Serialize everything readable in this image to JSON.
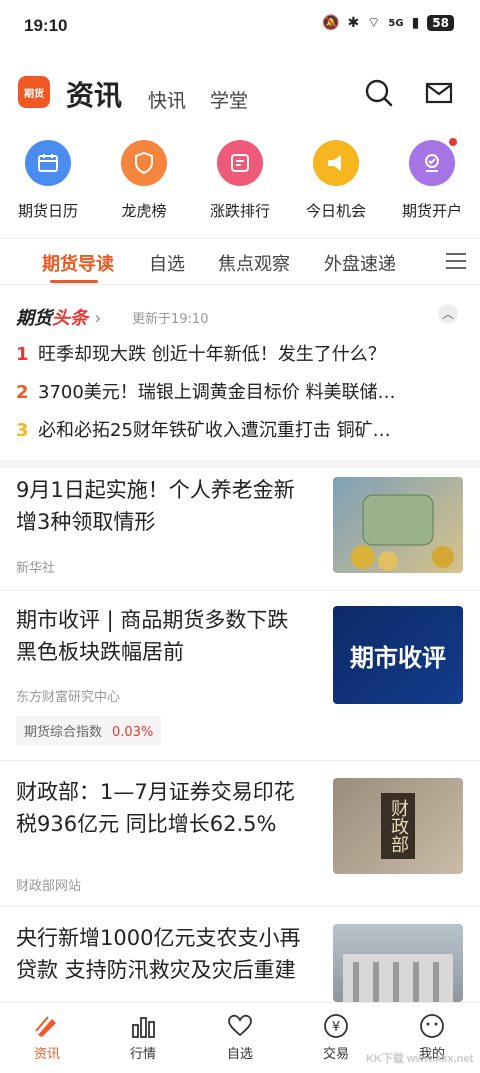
{
  "status_bar": {
    "time": "19:10",
    "battery": "58",
    "network": "5G"
  },
  "header": {
    "title": "资讯",
    "tabs": [
      "快讯",
      "学堂"
    ],
    "logo_text": "期货"
  },
  "shortcuts": [
    "期货日历",
    "龙虎榜",
    "涨跌排行",
    "今日机会",
    "期货开户"
  ],
  "categories": [
    "期货导读",
    "自选",
    "焦点观察",
    "外盘速递"
  ],
  "headlines": {
    "logo_a": "期货",
    "logo_b": "头条",
    "updated": "更新于19:10",
    "items": [
      {
        "rank": "1",
        "text": "旺季却现大跌 创近十年新低！发生了什么？"
      },
      {
        "rank": "2",
        "text": "3700美元！瑞银上调黄金目标价 料美联储…"
      },
      {
        "rank": "3",
        "text": "必和必拓25财年铁矿收入遭沉重打击 铜矿…"
      }
    ]
  },
  "news": [
    {
      "title": "9月1日起实施！个人养老金新增3种领取情形",
      "source": "新华社"
    },
    {
      "title": "期市收评 | 商品期货多数下跌 黑色板块跌幅居前",
      "source": "东方财富研究中心",
      "tag_label": "期货综合指数",
      "tag_value": "0.03%",
      "image_text": "期市收评"
    },
    {
      "title": "财政部：1—7月证券交易印花税936亿元 同比增长62.5%",
      "source": "财政部网站",
      "image_text": "财政部"
    },
    {
      "title": "央行新增1000亿元支农支小再贷款 支持防汛救灾及灾后重建",
      "source": ""
    }
  ],
  "bottom_nav": [
    "资讯",
    "行情",
    "自选",
    "交易",
    "我的"
  ],
  "watermark": "KK下载 www.kkx.net",
  "colors": {
    "accent": "#f05a22",
    "red": "#e53935"
  }
}
